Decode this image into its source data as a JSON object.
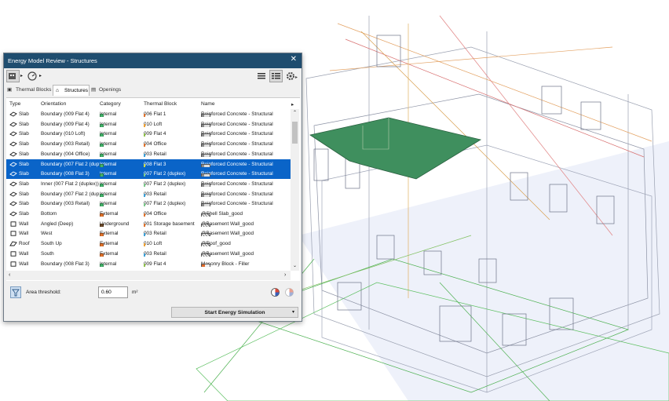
{
  "window": {
    "title": "Energy Model Review - Structures",
    "close_glyph": "✕"
  },
  "tabs": [
    {
      "label": "Thermal Blocks",
      "active": false
    },
    {
      "label": "Structures",
      "active": true
    },
    {
      "label": "Openings",
      "active": false
    }
  ],
  "columns": [
    "Type",
    "Orientation",
    "Category",
    "Thermal Block",
    "Name"
  ],
  "colors": {
    "internal": "#43b36a",
    "external": "#e0722b",
    "underground": "#6b4a2a",
    "selection": "#0a64c8",
    "titlebar": "#1f4d6f",
    "slab_highlight": "#3f8f5e"
  },
  "rows": [
    {
      "type": "Slab",
      "orientation": "Boundary (009 Flat 4)",
      "category": "Internal",
      "cat_color": "#43b36a",
      "block": "006 Flat 1",
      "block_color": "#e0722b",
      "name": "Reinforced Concrete - Structural",
      "name_icon": "concrete",
      "selected": false
    },
    {
      "type": "Slab",
      "orientation": "Boundary (009 Flat 4)",
      "category": "Internal",
      "cat_color": "#43b36a",
      "block": "010 Loft",
      "block_color": "#f0a030",
      "name": "Reinforced Concrete - Structural",
      "name_icon": "concrete",
      "selected": false
    },
    {
      "type": "Slab",
      "orientation": "Boundary (010 Loft)",
      "category": "Internal",
      "cat_color": "#43b36a",
      "block": "009 Flat 4",
      "block_color": "#8fc04a",
      "name": "Reinforced Concrete - Structural",
      "name_icon": "concrete",
      "selected": false
    },
    {
      "type": "Slab",
      "orientation": "Boundary (003 Retail)",
      "category": "Internal",
      "cat_color": "#43b36a",
      "block": "004 Office",
      "block_color": "#e0722b",
      "name": "Reinforced Concrete - Structural",
      "name_icon": "concrete",
      "selected": false
    },
    {
      "type": "Slab",
      "orientation": "Boundary (004 Office)",
      "category": "Internal",
      "cat_color": "#43b36a",
      "block": "003 Retail",
      "block_color": "#3aa0d8",
      "name": "Reinforced Concrete - Structural",
      "name_icon": "concrete",
      "selected": false
    },
    {
      "type": "Slab",
      "orientation": "Boundary (007 Flat 2 (duplex))",
      "category": "Internal",
      "cat_color": "#43b36a",
      "block": "008 Flat 3",
      "block_color": "#c8d84a",
      "name": "Reinforced Concrete - Structural",
      "name_icon": "concrete",
      "selected": true
    },
    {
      "type": "Slab",
      "orientation": "Boundary (008 Flat 3)",
      "category": "Internal",
      "cat_color": "#43b36a",
      "block": "007 Flat 2 (duplex)",
      "block_color": "#7ac88a",
      "name": "Reinforced Concrete - Structural",
      "name_icon": "concrete",
      "selected": true
    },
    {
      "type": "Slab",
      "orientation": "Inner (007 Flat 2 (duplex))",
      "category": "Internal",
      "cat_color": "#43b36a",
      "block": "007 Flat 2 (duplex)",
      "block_color": "#7ac88a",
      "name": "Reinforced Concrete - Structural",
      "name_icon": "concrete",
      "selected": false
    },
    {
      "type": "Slab",
      "orientation": "Boundary (007 Flat 2 (duplex))",
      "category": "Internal",
      "cat_color": "#43b36a",
      "block": "003 Retail",
      "block_color": "#3aa0d8",
      "name": "Reinforced Concrete - Structural",
      "name_icon": "concrete",
      "selected": false
    },
    {
      "type": "Slab",
      "orientation": "Boundary (003 Retail)",
      "category": "Internal",
      "cat_color": "#43b36a",
      "block": "007 Flat 2 (duplex)",
      "block_color": "#7ac88a",
      "name": "Reinforced Concrete - Structural",
      "name_icon": "concrete",
      "selected": false
    },
    {
      "type": "Slab",
      "orientation": "Bottom",
      "category": "External",
      "cat_color": "#e0722b",
      "block": "004 Office",
      "block_color": "#e0722b",
      "name": "@Shell Slab_good",
      "name_icon": "hatch",
      "selected": false
    },
    {
      "type": "Wall",
      "orientation": "Angled (Deep)",
      "category": "Underground",
      "cat_color": "#6b4a2a",
      "block": "001 Storage basement",
      "block_color": "#e0722b",
      "name": "@Basement Wall_good",
      "name_icon": "hatch",
      "selected": false
    },
    {
      "type": "Wall",
      "orientation": "West",
      "category": "External",
      "cat_color": "#e0722b",
      "block": "003 Retail",
      "block_color": "#3aa0d8",
      "name": "@Basement Wall_good",
      "name_icon": "hatch",
      "selected": false
    },
    {
      "type": "Roof",
      "orientation": "South Up",
      "category": "External",
      "cat_color": "#e0722b",
      "block": "010 Loft",
      "block_color": "#f0a030",
      "name": "@Roof_good",
      "name_icon": "hatch",
      "selected": false
    },
    {
      "type": "Wall",
      "orientation": "South",
      "category": "External",
      "cat_color": "#e0722b",
      "block": "003 Retail",
      "block_color": "#3aa0d8",
      "name": "@Basement Wall_good",
      "name_icon": "hatch",
      "selected": false
    },
    {
      "type": "Wall",
      "orientation": "Boundary (008 Flat 3)",
      "category": "Internal",
      "cat_color": "#43b36a",
      "block": "009 Flat 4",
      "block_color": "#8fc04a",
      "name": "Masonry Block - Filler",
      "name_icon": "brick",
      "selected": false
    },
    {
      "type": "Wall",
      "orientation": "Boundary (007 Flat 2 (duplex))",
      "category": "Internal",
      "cat_color": "#43b36a",
      "block": "006 Flat 1",
      "block_color": "#e0722b",
      "name": "Masonry Block - Filler",
      "name_icon": "brick",
      "selected": false
    }
  ],
  "filter": {
    "label": "Area threshold:",
    "value": "0.60",
    "unit": "m²"
  },
  "start_button": {
    "label": "Start Energy Simulation"
  }
}
